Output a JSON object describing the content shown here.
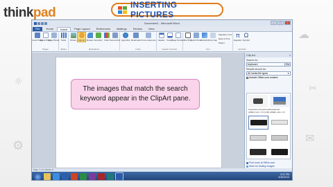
{
  "brand": {
    "think": "think",
    "pad": "pad"
  },
  "slide_title": "INSERTING PICTURES",
  "callout": {
    "line1": "The images that match the search",
    "line2": "keyword appear in the ClipArt pane."
  },
  "word": {
    "window_title": "Document1 - Microsoft Word",
    "tabs": [
      "File",
      "Home",
      "Insert",
      "Page Layout",
      "References",
      "Mailings",
      "Review",
      "View"
    ],
    "active_tab": "Insert",
    "ribbon": {
      "pages": {
        "name": "Pages",
        "buttons": [
          "Cover Page",
          "Blank Page",
          "Page Break"
        ]
      },
      "tables": {
        "name": "Tables",
        "buttons": [
          "Table"
        ]
      },
      "illustrations": {
        "name": "Illustrations",
        "buttons": [
          "Picture",
          "Clip Art",
          "Shapes",
          "SmartArt",
          "Chart",
          "Screenshot"
        ]
      },
      "links": {
        "name": "Links",
        "buttons": [
          "Hyperlink",
          "Bookmark",
          "Cross-reference"
        ]
      },
      "header_footer": {
        "name": "Header & Footer",
        "buttons": [
          "Header",
          "Footer",
          "Page Number"
        ]
      },
      "text": {
        "name": "Text",
        "buttons": [
          "Text Box",
          "Quick Parts",
          "WordArt",
          "Drop Cap"
        ]
      },
      "text_side": [
        "Signature Line",
        "Date & Time",
        "Object"
      ],
      "symbols": {
        "name": "Symbols",
        "buttons": [
          "Equation",
          "Symbol"
        ]
      }
    },
    "clipart_pane": {
      "title": "Clip Art",
      "search_label": "Search for:",
      "search_value": "keyboard",
      "go_label": "Go",
      "results_label": "Results should be:",
      "results_value": "All media file types",
      "include_office": "Include Office.com content",
      "thumb_caption": "Keyboard,Computers,Educational",
      "thumb_caption2": "(WMF) 144 x 72 (3.05) (WMF) 144 x 72",
      "link_office": "Find more at Office.com",
      "link_hints": "Hints for finding images"
    },
    "statusbar": "Page: 1 of 1   Words: 0",
    "tray_time": "3:21 PM",
    "tray_date": "5/26/2010"
  },
  "colors": {
    "accent_orange": "#e07b1a",
    "title_blue": "#1d4fa5",
    "callout_pink": "#f9d4ea",
    "file_tab": "#2a5aa8"
  }
}
